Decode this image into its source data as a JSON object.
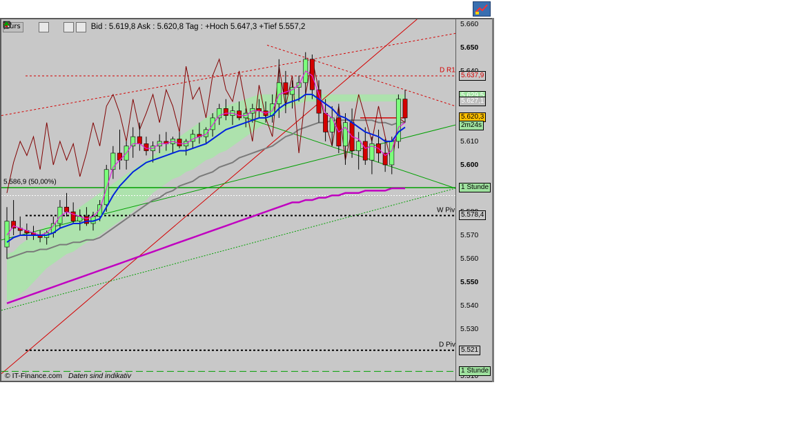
{
  "toolbar": {
    "title": "Kurs",
    "quote": "Bid : 5.619,8  Ask : 5.620,8  Tag : +Hoch 5.647,3 +Tief 5.557,2"
  },
  "footer": {
    "copyright": "© IT-Finance.com",
    "note": "Daten sind indikativ"
  },
  "axis": {
    "labels": [
      {
        "text": "5.660",
        "bold": false
      },
      {
        "text": "5.650",
        "bold": true
      },
      {
        "text": "5.640",
        "bold": false
      },
      {
        "text": "5.630",
        "bold": false
      },
      {
        "text": "5.620",
        "bold": false
      },
      {
        "text": "5.610",
        "bold": false
      },
      {
        "text": "5.600",
        "bold": true
      },
      {
        "text": "5.590",
        "bold": false
      },
      {
        "text": "5.580",
        "bold": false
      },
      {
        "text": "5.570",
        "bold": false
      },
      {
        "text": "5.560",
        "bold": false
      },
      {
        "text": "5.550",
        "bold": true
      },
      {
        "text": "5.540",
        "bold": false
      },
      {
        "text": "5.530",
        "bold": false
      },
      {
        "text": "5.520",
        "bold": false
      },
      {
        "text": "5.510",
        "bold": false
      }
    ]
  },
  "tags": [
    {
      "text": "5.637,9",
      "price": 5637.9,
      "bg": "#c8c8c8",
      "fg": "#d40000"
    },
    {
      "text": "5.629,5",
      "price": 5629.5,
      "bg": "#9fe29f",
      "fg": "#ffffff"
    },
    {
      "text": "5.627,1",
      "price": 5627.1,
      "bg": "#bdbdbd",
      "fg": "#ffffff"
    },
    {
      "text": "5.620,3",
      "price": 5620.3,
      "bg": "#ffc000",
      "fg": "#000000"
    },
    {
      "text": "2m24s",
      "price": 5616.8,
      "bg": "#9fe29f",
      "fg": "#000000"
    },
    {
      "text": "1 Stunde",
      "price": 5590.3,
      "bg": "#9fe29f",
      "fg": "#000000"
    },
    {
      "text": "5.578,4",
      "price": 5578.4,
      "bg": "#c8c8c8",
      "fg": "#000000"
    },
    {
      "text": "5.521",
      "price": 5521.0,
      "bg": "#c8c8c8",
      "fg": "#000000"
    },
    {
      "text": "1 Stunde",
      "price": 5512.0,
      "bg": "#9fe29f",
      "fg": "#000000"
    }
  ],
  "levels": [
    {
      "name": "D R1",
      "price": 5637.9,
      "color": "#d40000",
      "dash": "3,3",
      "label_color": "#d40000"
    },
    {
      "name": "W Piv",
      "price": 5578.4,
      "color": "#000000",
      "dash": "3,3",
      "label_color": "#000000"
    },
    {
      "name": "D Piv",
      "price": 5521.0,
      "color": "#000000",
      "dash": "3,3",
      "label_color": "#000000"
    }
  ],
  "fib_label": "5.586,9 (50,00%)",
  "chart_data": {
    "type": "candlestick",
    "title": "",
    "ylim": [
      5508,
      5662
    ],
    "colors": {
      "up": "#7cff7c",
      "down": "#d40000",
      "wick": "#000000",
      "ma_fast": "#0022dd",
      "ma_slow": "#7a7a7a",
      "ma_mid": "#e020e0",
      "ichimoku": "#a8e6a8",
      "osc": "#800000",
      "ma_long": "#c000c0"
    },
    "candles": [
      [
        5565,
        5582,
        5560,
        5576
      ],
      [
        5576,
        5585,
        5570,
        5573
      ],
      [
        5573,
        5578,
        5570,
        5572
      ],
      [
        5572,
        5575,
        5568,
        5571
      ],
      [
        5571,
        5574,
        5568,
        5570
      ],
      [
        5570,
        5572,
        5567,
        5569
      ],
      [
        5569,
        5572,
        5566,
        5571
      ],
      [
        5571,
        5578,
        5569,
        5575
      ],
      [
        5575,
        5585,
        5573,
        5582
      ],
      [
        5582,
        5588,
        5578,
        5580
      ],
      [
        5580,
        5584,
        5575,
        5576
      ],
      [
        5576,
        5581,
        5572,
        5578
      ],
      [
        5578,
        5582,
        5574,
        5575
      ],
      [
        5575,
        5580,
        5572,
        5578
      ],
      [
        5578,
        5585,
        5576,
        5583
      ],
      [
        5583,
        5600,
        5580,
        5598
      ],
      [
        5598,
        5608,
        5594,
        5605
      ],
      [
        5605,
        5615,
        5598,
        5602
      ],
      [
        5602,
        5610,
        5598,
        5608
      ],
      [
        5608,
        5616,
        5603,
        5612
      ],
      [
        5612,
        5618,
        5606,
        5609
      ],
      [
        5609,
        5612,
        5604,
        5606
      ],
      [
        5606,
        5610,
        5601,
        5608
      ],
      [
        5608,
        5613,
        5605,
        5610
      ],
      [
        5610,
        5614,
        5606,
        5609
      ],
      [
        5609,
        5612,
        5605,
        5611
      ],
      [
        5611,
        5614,
        5607,
        5608
      ],
      [
        5608,
        5611,
        5604,
        5610
      ],
      [
        5610,
        5615,
        5607,
        5613
      ],
      [
        5613,
        5618,
        5609,
        5612
      ],
      [
        5612,
        5616,
        5609,
        5615
      ],
      [
        5615,
        5622,
        5612,
        5620
      ],
      [
        5620,
        5626,
        5617,
        5624
      ],
      [
        5624,
        5628,
        5619,
        5621
      ],
      [
        5621,
        5625,
        5617,
        5623
      ],
      [
        5623,
        5627,
        5619,
        5620
      ],
      [
        5620,
        5624,
        5616,
        5622
      ],
      [
        5622,
        5626,
        5618,
        5624
      ],
      [
        5624,
        5628,
        5620,
        5623
      ],
      [
        5623,
        5627,
        5618,
        5621
      ],
      [
        5621,
        5630,
        5618,
        5626
      ],
      [
        5626,
        5645,
        5620,
        5635
      ],
      [
        5635,
        5640,
        5622,
        5630
      ],
      [
        5630,
        5636,
        5624,
        5633
      ],
      [
        5633,
        5638,
        5627,
        5635
      ],
      [
        5635,
        5648,
        5630,
        5645
      ],
      [
        5645,
        5647,
        5628,
        5632
      ],
      [
        5632,
        5636,
        5618,
        5622
      ],
      [
        5622,
        5628,
        5610,
        5614
      ],
      [
        5614,
        5625,
        5608,
        5620
      ],
      [
        5620,
        5626,
        5605,
        5608
      ],
      [
        5608,
        5622,
        5600,
        5618
      ],
      [
        5618,
        5624,
        5603,
        5606
      ],
      [
        5606,
        5614,
        5598,
        5610
      ],
      [
        5610,
        5616,
        5600,
        5602
      ],
      [
        5602,
        5612,
        5596,
        5609
      ],
      [
        5609,
        5615,
        5601,
        5605
      ],
      [
        5605,
        5611,
        5597,
        5600
      ],
      [
        5600,
        5612,
        5596,
        5610
      ],
      [
        5610,
        5630,
        5607,
        5628
      ],
      [
        5628,
        5632,
        5618,
        5620
      ]
    ],
    "ma_fast": [
      5567,
      5569,
      5570,
      5570,
      5570,
      5570,
      5570,
      5571,
      5573,
      5574,
      5575,
      5575,
      5576,
      5576,
      5577,
      5582,
      5587,
      5591,
      5594,
      5597,
      5599,
      5601,
      5602,
      5603,
      5604,
      5605,
      5606,
      5606,
      5607,
      5608,
      5609,
      5611,
      5613,
      5615,
      5616,
      5617,
      5618,
      5619,
      5620,
      5620,
      5621,
      5624,
      5626,
      5627,
      5628,
      5630,
      5630,
      5628,
      5626,
      5624,
      5621,
      5620,
      5618,
      5616,
      5614,
      5613,
      5612,
      5610,
      5610,
      5614,
      5616
    ],
    "ma_slow": [
      5560,
      5561,
      5562,
      5563,
      5563,
      5564,
      5564,
      5565,
      5566,
      5566,
      5567,
      5567,
      5568,
      5568,
      5569,
      5571,
      5573,
      5575,
      5577,
      5579,
      5581,
      5583,
      5585,
      5586,
      5588,
      5589,
      5591,
      5592,
      5593,
      5595,
      5596,
      5597,
      5599,
      5600,
      5601,
      5603,
      5604,
      5605,
      5606,
      5607,
      5608,
      5610,
      5612,
      5613,
      5615,
      5616,
      5617,
      5618,
      5618,
      5619,
      5619,
      5619,
      5619,
      5619,
      5619,
      5619,
      5618,
      5618,
      5617,
      5618,
      5618
    ],
    "ma_mid": [
      5570,
      5574,
      5573,
      5572,
      5571,
      5570,
      5571,
      5574,
      5578,
      5580,
      5579,
      5578,
      5577,
      5578,
      5581,
      5590,
      5599,
      5602,
      5605,
      5609,
      5609,
      5607,
      5607,
      5609,
      5609,
      5610,
      5609,
      5609,
      5611,
      5612,
      5613,
      5617,
      5621,
      5622,
      5622,
      5621,
      5621,
      5623,
      5623,
      5622,
      5623,
      5630,
      5631,
      5632,
      5634,
      5640,
      5638,
      5630,
      5622,
      5620,
      5614,
      5616,
      5612,
      5611,
      5607,
      5608,
      5607,
      5604,
      5606,
      5616,
      5618
    ],
    "ma_long": [
      5541,
      5542,
      5543,
      5544,
      5545,
      5546,
      5547,
      5548,
      5549,
      5550,
      5551,
      5552,
      5553,
      5554,
      5555,
      5556,
      5557,
      5558,
      5559,
      5560,
      5561,
      5562,
      5563,
      5564,
      5565,
      5566,
      5567,
      5568,
      5569,
      5570,
      5571,
      5572,
      5573,
      5574,
      5575,
      5576,
      5577,
      5578,
      5579,
      5580,
      5581,
      5582,
      5583,
      5584,
      5584,
      5585,
      5585,
      5586,
      5586,
      5587,
      5587,
      5588,
      5588,
      5588,
      5589,
      5589,
      5589,
      5589,
      5590,
      5590,
      5590
    ],
    "osc": [
      5588,
      5601,
      5610,
      5604,
      5612,
      5598,
      5618,
      5600,
      5610,
      5602,
      5609,
      5595,
      5605,
      5618,
      5608,
      5625,
      5630,
      5622,
      5610,
      5628,
      5615,
      5622,
      5630,
      5618,
      5632,
      5625,
      5614,
      5642,
      5628,
      5633,
      5620,
      5638,
      5645,
      5632,
      5627,
      5640,
      5625,
      5610,
      5634,
      5620,
      5612,
      5642,
      5625,
      5638,
      5605,
      5630,
      5645,
      5632,
      5618,
      5608,
      5625,
      5602,
      5615,
      5630,
      5620,
      5610,
      5625,
      5612,
      5600,
      5620,
      5618
    ],
    "cloud_top": [
      5562,
      5563,
      5566,
      5568,
      5570,
      5572,
      5574,
      5575,
      5576,
      5578,
      5580,
      5582,
      5584,
      5586,
      5588,
      5590,
      5592,
      5594,
      5596,
      5598,
      5600,
      5602,
      5604,
      5606,
      5608,
      5610,
      5612,
      5614,
      5616,
      5618,
      5620,
      5622,
      5624,
      5625,
      5626,
      5627,
      5628,
      5629,
      5630,
      5630,
      5630,
      5630,
      5630,
      5630,
      5630,
      5630,
      5630,
      5630,
      5630,
      5630,
      5630,
      5630,
      5630,
      5630,
      5630,
      5630,
      5630,
      5630,
      5630,
      5630,
      5630
    ],
    "cloud_bottom": [
      5542,
      5543,
      5545,
      5547,
      5550,
      5553,
      5556,
      5558,
      5560,
      5562,
      5563,
      5565,
      5567,
      5568,
      5570,
      5572,
      5574,
      5576,
      5578,
      5580,
      5583,
      5585,
      5588,
      5590,
      5592,
      5594,
      5595,
      5597,
      5598,
      5600,
      5602,
      5603,
      5605,
      5606,
      5608,
      5610,
      5612,
      5614,
      5616,
      5618,
      5620,
      5622,
      5624,
      5625,
      5626,
      5627,
      5627,
      5627,
      5627,
      5627,
      5627,
      5627,
      5627,
      5627,
      5627,
      5627,
      5627,
      5627,
      5627,
      5627,
      5627
    ]
  }
}
